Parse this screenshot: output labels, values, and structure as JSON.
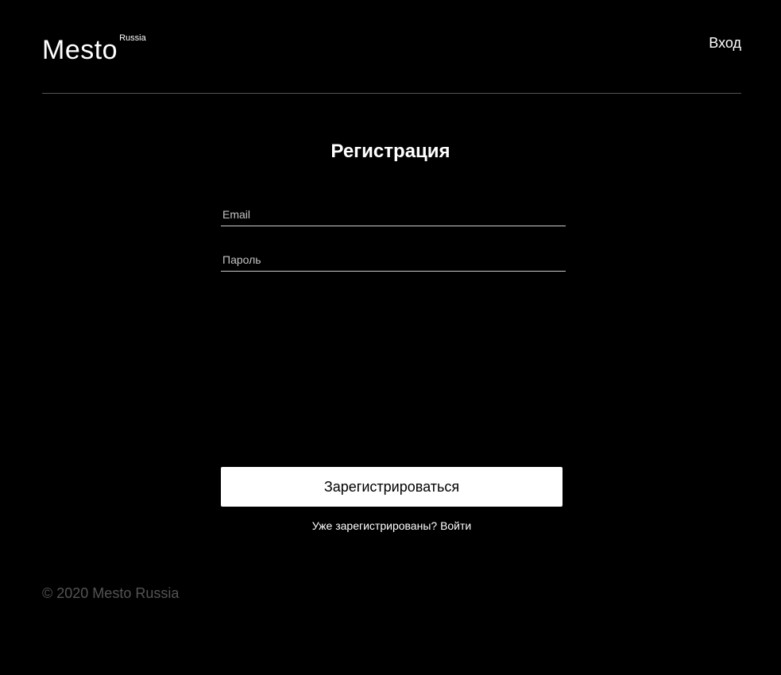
{
  "header": {
    "logo_text": "Mesto",
    "logo_superscript": "Russia",
    "login_link": "Вход"
  },
  "form": {
    "title": "Регистрация",
    "email_placeholder": "Email",
    "email_value": "",
    "password_placeholder": "Пароль",
    "password_value": "",
    "submit_label": "Зарегистрироваться",
    "already_registered_text": "Уже зарегистрированы?",
    "signin_link": "Войти"
  },
  "footer": {
    "copyright": "© 2020 Mesto Russia"
  },
  "colors": {
    "background": "#000000",
    "text": "#ffffff",
    "footer_text": "#545454",
    "divider": "#545454",
    "button_background": "#ffffff",
    "button_text": "#000000"
  }
}
